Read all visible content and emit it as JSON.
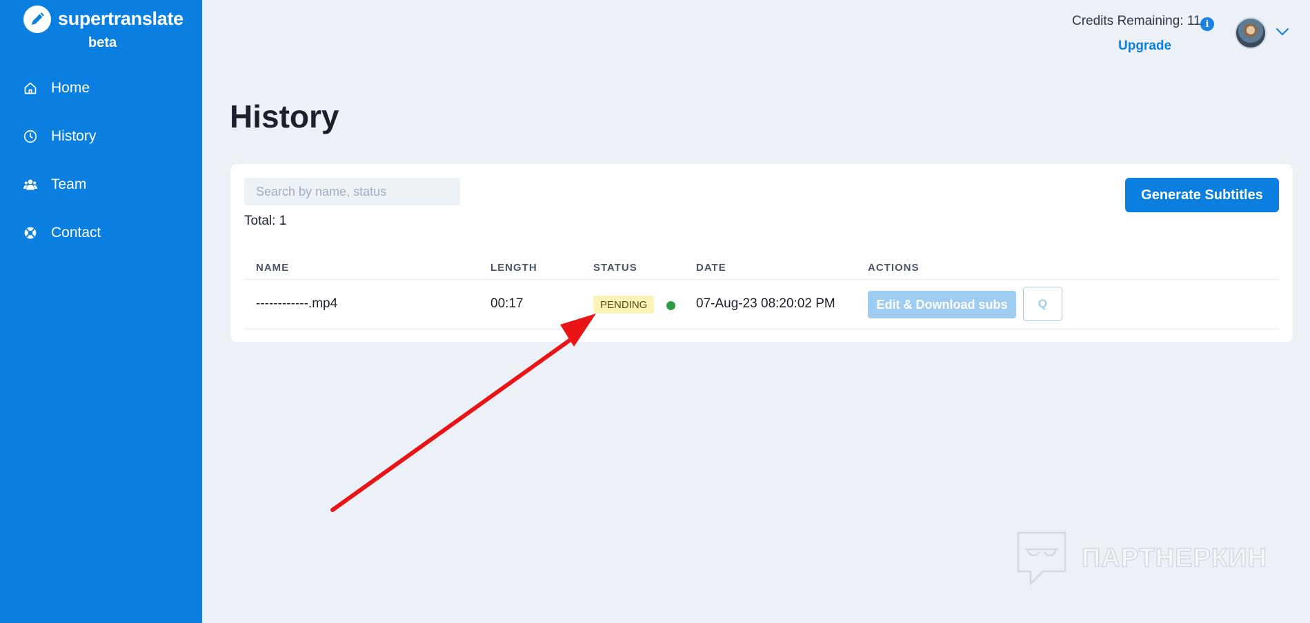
{
  "brand": {
    "name": "supertranslate",
    "tag": "beta"
  },
  "sidebar": {
    "items": [
      {
        "label": "Home",
        "icon": "home-icon"
      },
      {
        "label": "History",
        "icon": "clock-icon"
      },
      {
        "label": "Team",
        "icon": "team-icon"
      },
      {
        "label": "Contact",
        "icon": "lifebuoy-icon"
      }
    ]
  },
  "header": {
    "credits_label": "Credits Remaining: 11",
    "info_glyph": "i",
    "upgrade_label": "Upgrade"
  },
  "page": {
    "title": "History"
  },
  "search": {
    "placeholder": "Search by name, status",
    "value": ""
  },
  "summary": {
    "total_label": "Total: ",
    "total_value": "1"
  },
  "actions": {
    "generate_label": "Generate Subtitles"
  },
  "table": {
    "columns": [
      "NAME",
      "LENGTH",
      "STATUS",
      "DATE",
      "ACTIONS"
    ],
    "rows": [
      {
        "name": "------------.mp4",
        "length": "00:17",
        "status": "PENDING",
        "date": "07-Aug-23 08:20:02 PM",
        "edit_label": "Edit & Download subs",
        "q_label": "Q"
      }
    ]
  },
  "watermark": {
    "text": "ПАРТНЕРКИН"
  },
  "colors": {
    "sidebar": "#0a7fe0",
    "background": "#ecf1f8",
    "accent": "#0a7fe0",
    "pending_badge": "#fbf3b7",
    "status_dot": "#2e9e45",
    "annotation_arrow": "#e81416"
  }
}
